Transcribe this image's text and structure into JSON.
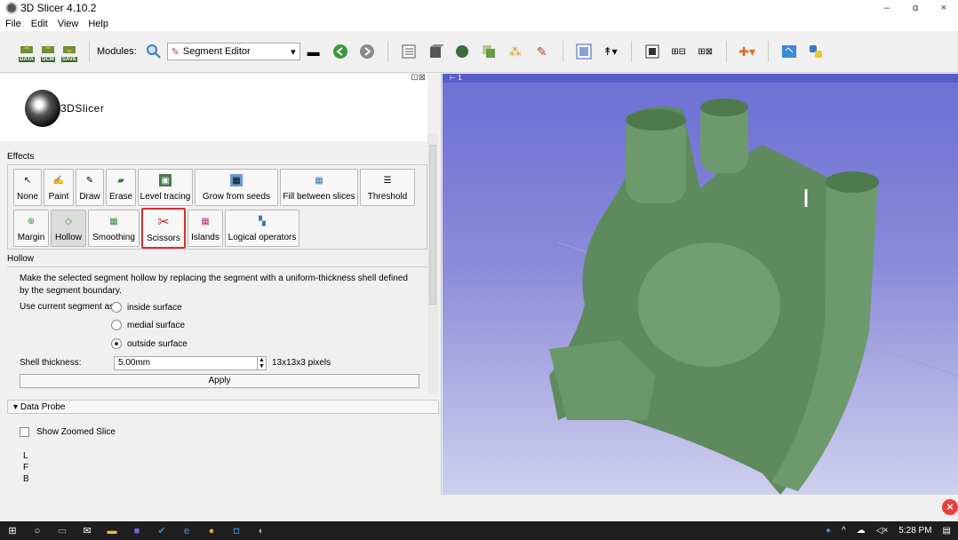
{
  "window": {
    "title": "3D Slicer 4.10.2",
    "min": "–",
    "max": "ɑ",
    "close": "×"
  },
  "menu": [
    "File",
    "Edit",
    "View",
    "Help"
  ],
  "toolbar": {
    "data_label": "DATA",
    "dcm_label": "DCM",
    "save_label": "SAVE",
    "modules_label": "Modules:",
    "module_selected": "Segment Editor"
  },
  "logo": {
    "text": "3DSlicer"
  },
  "effects": {
    "header": "Effects",
    "row1": [
      "None",
      "Paint",
      "Draw",
      "Erase",
      "Level tracing",
      "Grow from seeds",
      "Fill between slices",
      "Threshold"
    ],
    "row2": [
      "Margin",
      "Hollow",
      "Smoothing",
      "Scissors",
      "Islands",
      "Logical operators"
    ]
  },
  "hollow": {
    "header": "Hollow",
    "description": "Make the selected segment hollow by replacing the segment with a uniform-thickness shell defined by the segment boundary.",
    "use_current_label": "Use current segment as:",
    "options": [
      "inside surface",
      "medial surface",
      "outside surface"
    ],
    "selected_option": "outside surface",
    "shell_label": "Shell thickness:",
    "shell_value": "5.00mm",
    "pixels": "13x13x3 pixels",
    "apply": "Apply"
  },
  "data_probe": {
    "header": "Data Probe",
    "show_zoomed": "Show Zoomed Slice",
    "values": [
      "L",
      "F",
      "B"
    ]
  },
  "viewer": {
    "label": "1",
    "background": "#7a7bd4",
    "model_color": "#5e8a5e"
  },
  "taskbar": {
    "time": "5:28 PM"
  }
}
